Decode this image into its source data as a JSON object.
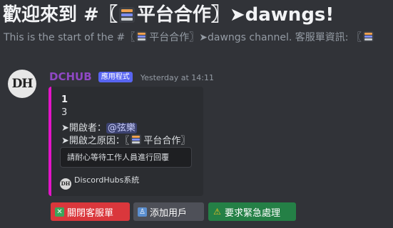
{
  "channel": {
    "welcome_prefix": "歡迎來到 #〖",
    "welcome_suffix": "平台合作〗➤dawngs!",
    "desc_prefix": "This is the start of the #〖",
    "desc_suffix": "平台合作〗➤dawngs channel. 客服單資訊: 〖"
  },
  "message": {
    "avatar_text": "DH",
    "username": "DCHUB",
    "app_badge": "應用程式",
    "timestamp": "Yesterday at 14:11"
  },
  "embed": {
    "border_color": "#e414c8",
    "line1": "1",
    "line2": "3",
    "opener_label": "➤開啟者：",
    "opener_mention": "@弦樂",
    "reason_prefix": "➤開啟之原因：〖",
    "reason_suffix": "平台合作〗",
    "field_text": "請耐心等待工作人員進行回覆",
    "footer_text": "DiscordHubs系統"
  },
  "buttons": {
    "close_label": "關閉客服單",
    "add_label": "添加用戶",
    "urgent_label": "要求緊急處理",
    "close_icon": "x-mark-icon",
    "add_icon": "person-icon",
    "urgent_icon": "warning-icon"
  }
}
